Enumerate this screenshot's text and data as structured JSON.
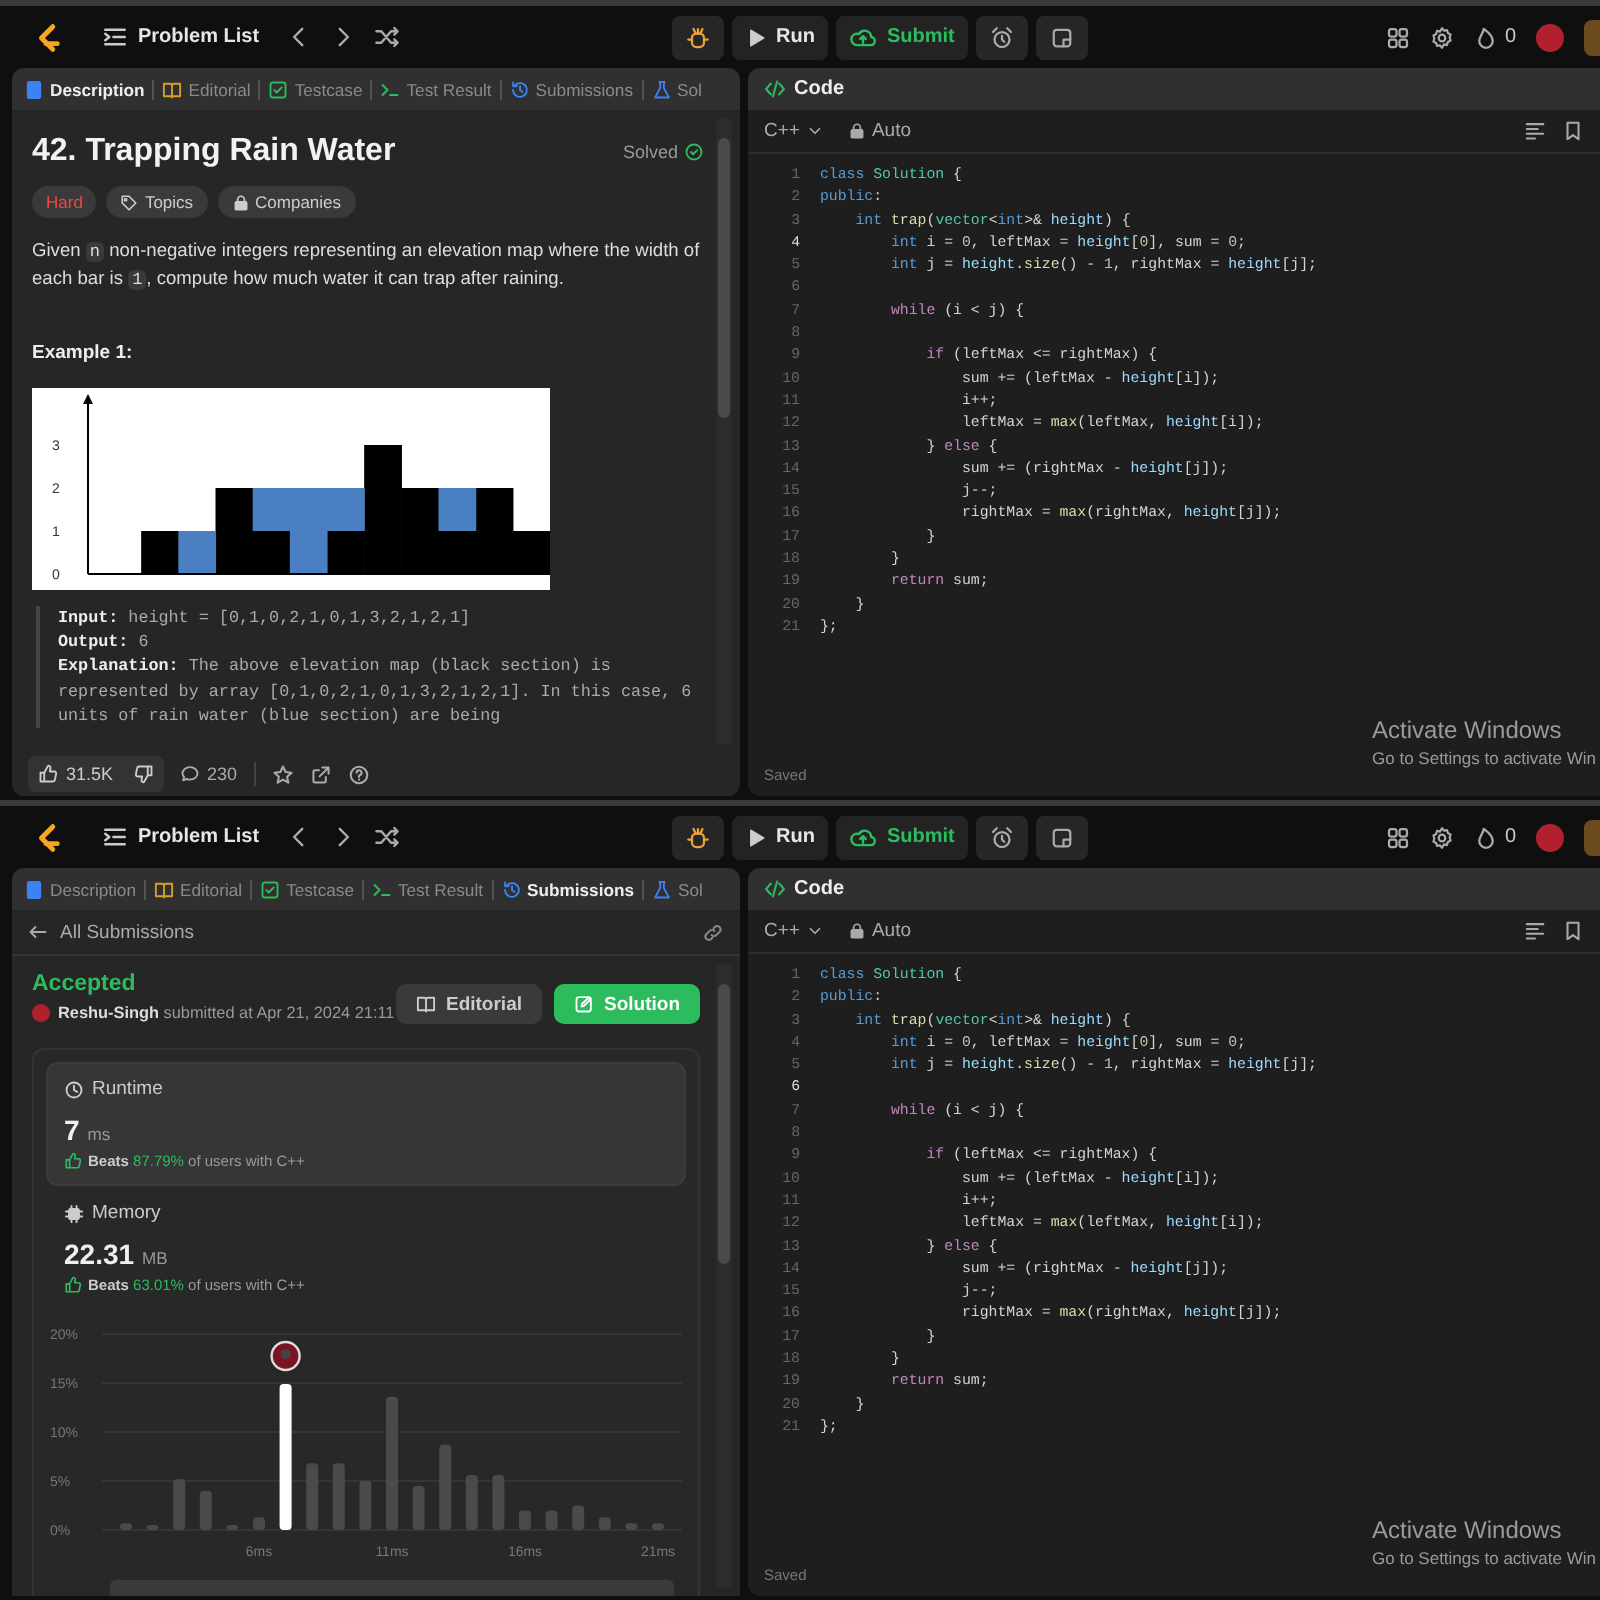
{
  "screens": [
    {
      "kind": "problem",
      "nav": {
        "title": "Problem List",
        "run": "Run",
        "submit": "Submit",
        "streak": "0"
      },
      "tabs": [
        {
          "label": "Description",
          "kind": "description",
          "selected": true
        },
        {
          "label": "Editorial",
          "kind": "editorial",
          "selected": false
        },
        {
          "label": "Testcase",
          "kind": "testcase",
          "selected": false
        },
        {
          "label": "Test Result",
          "kind": "result",
          "selected": false
        },
        {
          "label": "Submissions",
          "kind": "submissions",
          "selected": false
        },
        {
          "label": "Sol",
          "kind": "solutions",
          "selected": false
        }
      ],
      "problem": {
        "title": "42. Trapping Rain Water",
        "status": "Solved",
        "tags": [
          {
            "label": "Hard",
            "kind": "difficulty"
          },
          {
            "label": "Topics",
            "kind": "topics"
          },
          {
            "label": "Companies",
            "kind": "companies"
          }
        ],
        "description": [
          {
            "text": "Given ",
            "kind": "plain"
          },
          {
            "text": "n",
            "kind": "code"
          },
          {
            "text": " non-negative integers representing an elevation map where the width of each bar is ",
            "kind": "plain"
          },
          {
            "text": "1",
            "kind": "code"
          },
          {
            "text": ", compute how much water it can trap after raining.",
            "kind": "plain"
          }
        ],
        "example_title": "Example 1:",
        "chart_data": {
          "type": "bar",
          "stacked": true,
          "ylim": [
            0,
            4
          ],
          "yticks": [
            0,
            1,
            2,
            3
          ],
          "series": [
            {
              "color": "#000000",
              "values": [
                0,
                1,
                0,
                2,
                1,
                0,
                1,
                3,
                2,
                1,
                2,
                1
              ]
            },
            {
              "color": "#4a7fc1",
              "values": [
                0,
                0,
                1,
                0,
                1,
                2,
                1,
                0,
                0,
                1,
                0,
                0
              ]
            }
          ]
        },
        "example_lines": [
          "**Input:** height = [0,1,0,2,1,0,1,3,2,1,2,1]",
          "**Output:** 6",
          "**Explanation:** The above elevation map (black section) is represented by array [0,1,0,2,1,0,1,3,2,1,2,1]. In this case, 6 units of rain water (blue section) are being"
        ],
        "likes": "31.5K",
        "comments": "230"
      },
      "code": {
        "title": "Code",
        "language": "C++",
        "mode": "Auto",
        "status": "Saved",
        "watermark": [
          "Activate Windows",
          "Go to Settings to activate Win"
        ],
        "lines": [
          {
            "no": "1",
            "text": "class Solution {",
            "current": false
          },
          {
            "no": "2",
            "text": "public:",
            "current": false
          },
          {
            "no": "3",
            "text": "    int trap(vector<int>& height) {",
            "current": false
          },
          {
            "no": "4",
            "text": "        int i = 0, leftMax = height[0], sum = 0;",
            "current": true
          },
          {
            "no": "5",
            "text": "        int j = height.size() - 1, rightMax = height[j];",
            "current": false
          },
          {
            "no": "6",
            "current": false
          },
          {
            "no": "7",
            "text": "        while (i < j) {",
            "current": false
          },
          {
            "no": "8",
            "current": false
          },
          {
            "no": "9",
            "text": "            if (leftMax <= rightMax) {",
            "current": false
          },
          {
            "no": "10",
            "text": "                sum += (leftMax - height[i]);",
            "current": false
          },
          {
            "no": "11",
            "text": "                i++;",
            "current": false
          },
          {
            "no": "12",
            "text": "                leftMax = max(leftMax, height[i]);",
            "current": false
          },
          {
            "no": "13",
            "text": "            } else {",
            "current": false
          },
          {
            "no": "14",
            "text": "                sum += (rightMax - height[j]);",
            "current": false
          },
          {
            "no": "15",
            "text": "                j--;",
            "current": false
          },
          {
            "no": "16",
            "text": "                rightMax = max(rightMax, height[j]);",
            "current": false
          },
          {
            "no": "17",
            "text": "            }",
            "current": false
          },
          {
            "no": "18",
            "text": "        }",
            "current": false
          },
          {
            "no": "19",
            "text": "        return sum;",
            "current": false
          },
          {
            "no": "20",
            "text": "    }",
            "current": false
          },
          {
            "no": "21",
            "text": "};",
            "current": false
          }
        ]
      }
    },
    {
      "kind": "submission",
      "nav": {
        "title": "Problem List",
        "run": "Run",
        "submit": "Submit",
        "streak": "0"
      },
      "tabs": [
        {
          "label": "Description",
          "kind": "description",
          "selected": false
        },
        {
          "label": "Editorial",
          "kind": "editorial",
          "selected": false
        },
        {
          "label": "Testcase",
          "kind": "testcase",
          "selected": false
        },
        {
          "label": "Test Result",
          "kind": "result",
          "selected": false
        },
        {
          "label": "Submissions",
          "kind": "submissions",
          "selected": true
        },
        {
          "label": "Sol",
          "kind": "solutions",
          "selected": false
        }
      ],
      "submission": {
        "back": "All Submissions",
        "verdict": "Accepted",
        "user": "Reshu-Singh",
        "submitted": "submitted at Apr 21, 2024 21:11",
        "buttons": [
          {
            "label": "Editorial",
            "kind": "secondary"
          },
          {
            "label": "Solution",
            "kind": "primary"
          }
        ],
        "metrics": [
          {
            "kind": "runtime",
            "label": "Runtime",
            "value": "7",
            "unit": "ms",
            "beats_label": "Beats",
            "beats": "87.79%",
            "beats_rest": "of users with C++",
            "selected": true
          },
          {
            "kind": "memory",
            "label": "Memory",
            "value": "22.31",
            "unit": "MB",
            "beats_label": "Beats",
            "beats": "63.01%",
            "beats_rest": "of users with C++",
            "selected": false
          }
        ],
        "chart_data": {
          "type": "bar",
          "x": [
            1,
            2,
            3,
            4,
            5,
            6,
            7,
            8,
            9,
            10,
            11,
            12,
            13,
            14,
            15,
            16,
            17,
            18,
            19,
            20,
            21
          ],
          "xticks": [
            {
              "value": 6,
              "label": "6ms"
            },
            {
              "value": 11,
              "label": "11ms"
            },
            {
              "value": 16,
              "label": "16ms"
            },
            {
              "value": 21,
              "label": "21ms"
            }
          ],
          "yticks": [
            {
              "value": 0,
              "label": "0%"
            },
            {
              "value": 5,
              "label": "5%"
            },
            {
              "value": 10,
              "label": "10%"
            },
            {
              "value": 15,
              "label": "15%"
            },
            {
              "value": 20,
              "label": "20%"
            }
          ],
          "xlim": [
            1,
            21
          ],
          "ylim": [
            0,
            20
          ],
          "grid": true,
          "series": [
            {
              "color": "#4a4a4a",
              "values": [
                0.7,
                0.5,
                5.2,
                4,
                0.5,
                1.3,
                null,
                6.8,
                6.8,
                5,
                13.6,
                4.5,
                8.7,
                5.6,
                5.6,
                2,
                2,
                2.5,
                1.3,
                0.7,
                0.7
              ]
            },
            {
              "color": "#ffffff",
              "values": [
                null,
                null,
                null,
                null,
                null,
                null,
                14.9,
                null,
                null,
                null,
                null,
                null,
                null,
                null,
                null,
                null,
                null,
                null,
                null,
                null,
                null
              ]
            }
          ]
        }
      },
      "code": {
        "title": "Code",
        "language": "C++",
        "mode": "Auto",
        "status": "Saved",
        "watermark": [
          "Activate Windows",
          "Go to Settings to activate Win"
        ],
        "lines": [
          {
            "no": "1",
            "text": "class Solution {",
            "current": false
          },
          {
            "no": "2",
            "text": "public:",
            "current": false
          },
          {
            "no": "3",
            "text": "    int trap(vector<int>& height) {",
            "current": false
          },
          {
            "no": "4",
            "text": "        int i = 0, leftMax = height[0], sum = 0;",
            "current": false
          },
          {
            "no": "5",
            "text": "        int j = height.size() - 1, rightMax = height[j];",
            "current": false
          },
          {
            "no": "6",
            "current": true
          },
          {
            "no": "7",
            "text": "        while (i < j) {",
            "current": false
          },
          {
            "no": "8",
            "current": false
          },
          {
            "no": "9",
            "text": "            if (leftMax <= rightMax) {",
            "current": false
          },
          {
            "no": "10",
            "text": "                sum += (leftMax - height[i]);",
            "current": false
          },
          {
            "no": "11",
            "text": "                i++;",
            "current": false
          },
          {
            "no": "12",
            "text": "                leftMax = max(leftMax, height[i]);",
            "current": false
          },
          {
            "no": "13",
            "text": "            } else {",
            "current": false
          },
          {
            "no": "14",
            "text": "                sum += (rightMax - height[j]);",
            "current": false
          },
          {
            "no": "15",
            "text": "                j--;",
            "current": false
          },
          {
            "no": "16",
            "text": "                rightMax = max(rightMax, height[j]);",
            "current": false
          },
          {
            "no": "17",
            "text": "            }",
            "current": false
          },
          {
            "no": "18",
            "text": "        }",
            "current": false
          },
          {
            "no": "19",
            "text": "        return sum;",
            "current": false
          },
          {
            "no": "20",
            "text": "    }",
            "current": false
          },
          {
            "no": "21",
            "text": "};",
            "current": false
          }
        ]
      }
    }
  ]
}
